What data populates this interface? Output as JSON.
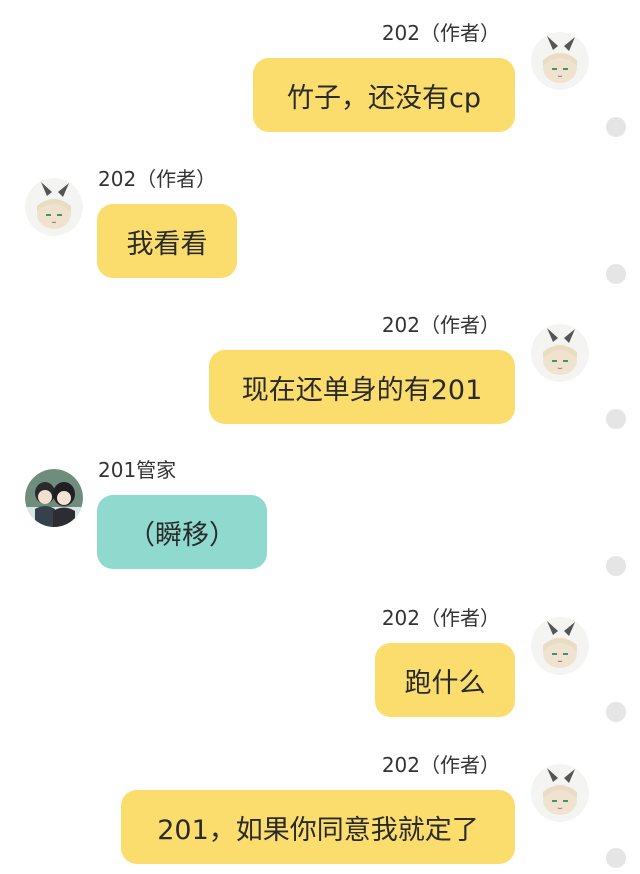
{
  "colors": {
    "yellow_bubble": "#fbdd6e",
    "teal_bubble": "#8fd9cf",
    "status_dot": "#e5e5e5"
  },
  "icons": {
    "author_avatar": "chibi-character-avatar",
    "butler_avatar": "anime-duo-avatar",
    "status": "read-status-dot"
  },
  "messages": [
    {
      "side": "right",
      "name": "202（作者）",
      "text": "竹子，还没有cp",
      "color": "yellow"
    },
    {
      "side": "left",
      "name": "202（作者）",
      "text": "我看看",
      "color": "yellow"
    },
    {
      "side": "right",
      "name": "202（作者）",
      "text": "现在还单身的有201",
      "color": "yellow"
    },
    {
      "side": "left",
      "name": "201管家",
      "text": "（瞬移）",
      "color": "teal"
    },
    {
      "side": "right",
      "name": "202（作者）",
      "text": "跑什么",
      "color": "yellow"
    },
    {
      "side": "right",
      "name": "202（作者）",
      "text": "201，如果你同意我就定了",
      "color": "yellow"
    }
  ]
}
